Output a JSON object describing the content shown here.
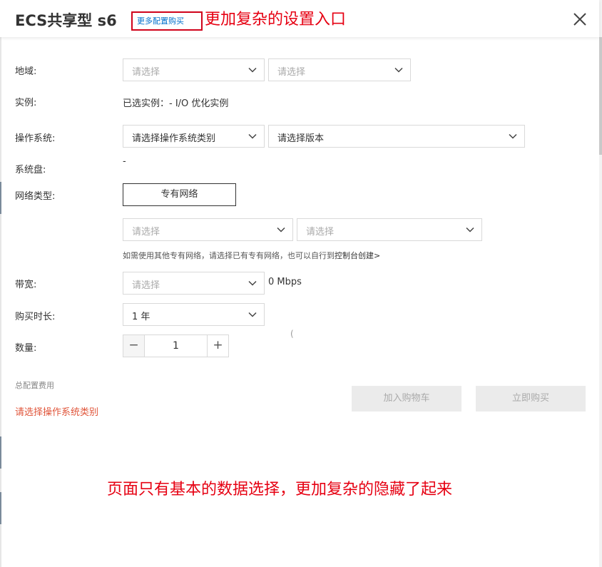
{
  "header": {
    "title": "ECS共享型 s6",
    "more_config_link": "更多配置购买",
    "annotation": "更加复杂的设置入口"
  },
  "form": {
    "region": {
      "label": "地域:",
      "select1_placeholder": "请选择",
      "select2_placeholder": "请选择"
    },
    "instance": {
      "label": "实例:",
      "value": "已选实例：- I/O 优化实例"
    },
    "os": {
      "label": "操作系统:",
      "type_placeholder": "请选择操作系统类别",
      "version_placeholder": "请选择版本"
    },
    "system_disk": {
      "label": "系统盘:",
      "value": "-"
    },
    "network": {
      "label": "网络类型:",
      "button_label": "专有网络",
      "vpc_placeholder": "请选择",
      "vswitch_placeholder": "请选择",
      "hint": "如需使用其他专有网络，请选择已有专有网络，也可以自行到",
      "hint_link": "控制台创建>"
    },
    "bandwidth": {
      "label": "带宽:",
      "placeholder": "请选择",
      "value": "0 Mbps"
    },
    "duration": {
      "label": "购买时长:",
      "value": "1 年"
    },
    "quantity": {
      "label": "数量:",
      "value": "1",
      "minus": "−",
      "plus": "+"
    },
    "stray_char": "("
  },
  "summary": {
    "total_label": "总配置费用",
    "total_value": "请选择操作系统类别"
  },
  "actions": {
    "add_to_cart": "加入购物车",
    "buy_now": "立即购买"
  },
  "annotation_bottom": "页面只有基本的数据选择，更加复杂的隐藏了起来",
  "colors": {
    "annotation_red": "#e60012",
    "link_blue": "#0070cc",
    "total_orange": "#e0553a",
    "disabled_bg": "#ebebeb"
  }
}
